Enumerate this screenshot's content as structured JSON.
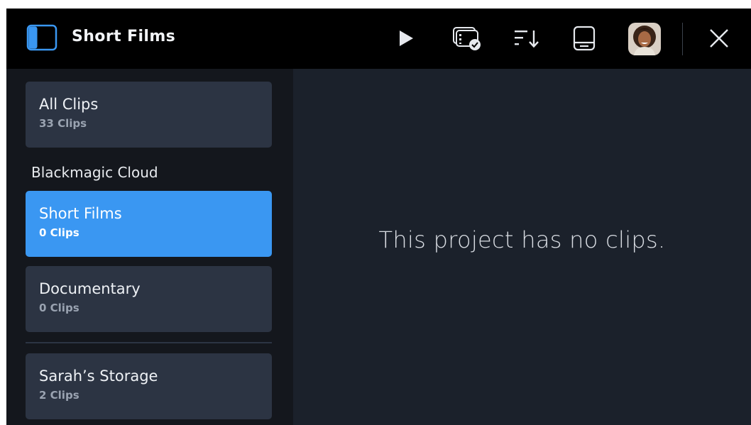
{
  "header": {
    "title": "Short Films",
    "icons": {
      "sidebar_toggle": "sidebar-toggle-icon",
      "play": "play-icon",
      "clip_select": "clip-select-icon",
      "sort": "sort-icon",
      "storage": "storage-drive-icon",
      "close": "close-icon"
    },
    "accent_color": "#3a97f2"
  },
  "sidebar": {
    "all_clips": {
      "name": "All Clips",
      "count": "33 Clips"
    },
    "cloud_section": "Blackmagic Cloud",
    "projects": [
      {
        "name": "Short Films",
        "count": "0 Clips",
        "selected": true
      },
      {
        "name": "Documentary",
        "count": "0 Clips",
        "selected": false
      }
    ],
    "storage": {
      "name": "Sarah’s Storage",
      "count": "2 Clips"
    }
  },
  "main": {
    "empty_message": "This project has no clips."
  }
}
